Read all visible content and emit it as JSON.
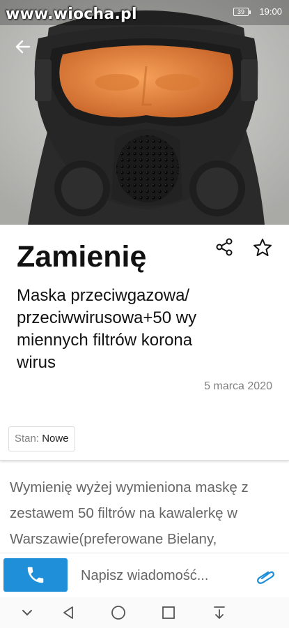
{
  "status_bar": {
    "watermark": "www.wiocha.pl",
    "battery": "39",
    "time": "19:00"
  },
  "listing": {
    "title": "Zamienię",
    "subtitle": "Maska przeciwgazowa/przeciwwirusowa+50 wymiennych filtrów koronawirus",
    "date": "5 marca 2020",
    "condition_label": "Stan:",
    "condition_value": "Nowe",
    "description": "Wymienię wyżej wymieniona maskę z zestawem 50 filtrów na kawalerkę w Warszawie(preferowane Bielany,"
  },
  "action_bar": {
    "message_placeholder": "Napisz wiadomość..."
  },
  "icons": {
    "back": "arrow-left-icon",
    "share": "share-icon",
    "favorite": "star-icon",
    "call": "phone-icon",
    "attach": "paperclip-icon",
    "nav_hide": "chevron-down-icon",
    "nav_back": "triangle-back-icon",
    "nav_home": "circle-home-icon",
    "nav_recents": "square-recents-icon",
    "nav_notifications": "pull-down-icon"
  },
  "colors": {
    "accent": "#1e8fd8",
    "date_text": "#808080",
    "description_text": "#666666",
    "mask_visor": "#e98a3f"
  }
}
